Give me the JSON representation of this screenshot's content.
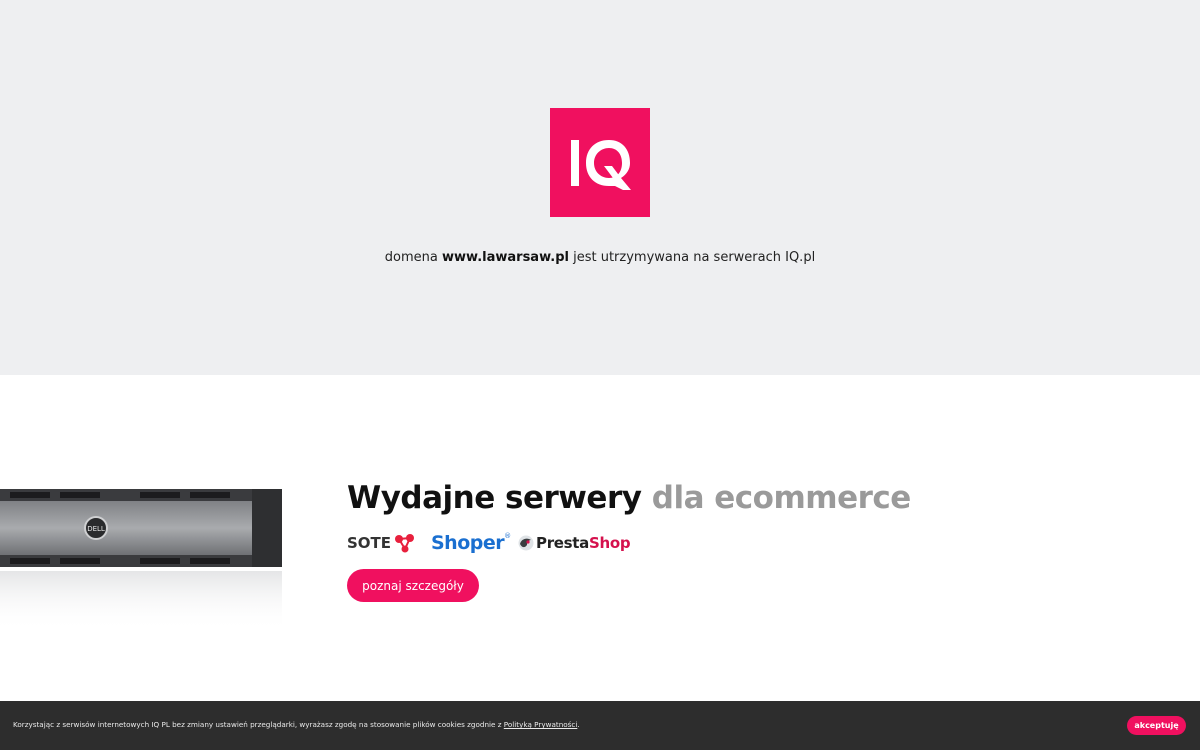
{
  "brand": {
    "logo_text": "IQ",
    "accent": "#f0105f",
    "top_bg": "#eeeff1"
  },
  "tagline": {
    "prefix": "domena ",
    "domain": "www.lawarsaw.pl",
    "suffix": " jest utrzymywana na serwerach IQ.pl"
  },
  "promo": {
    "title_main": "Wydajne serwery ",
    "title_muted": "dla ecommerce",
    "server_badge": "DELL",
    "partners": {
      "sote": "SOTE",
      "shoper": "Shoper",
      "shoper_mark": "®",
      "presta_a": "Presta",
      "presta_b": "Shop"
    },
    "cta": "poznaj szczegóły"
  },
  "cookie": {
    "text": "Korzystając z serwisów internetowych IQ PL bez zmiany ustawień przeglądarki, wyrażasz zgodę na stosowanie plików cookies zgodnie z ",
    "link": "Polityką Prywatności",
    "end": ".",
    "accept": "akceptuję"
  }
}
